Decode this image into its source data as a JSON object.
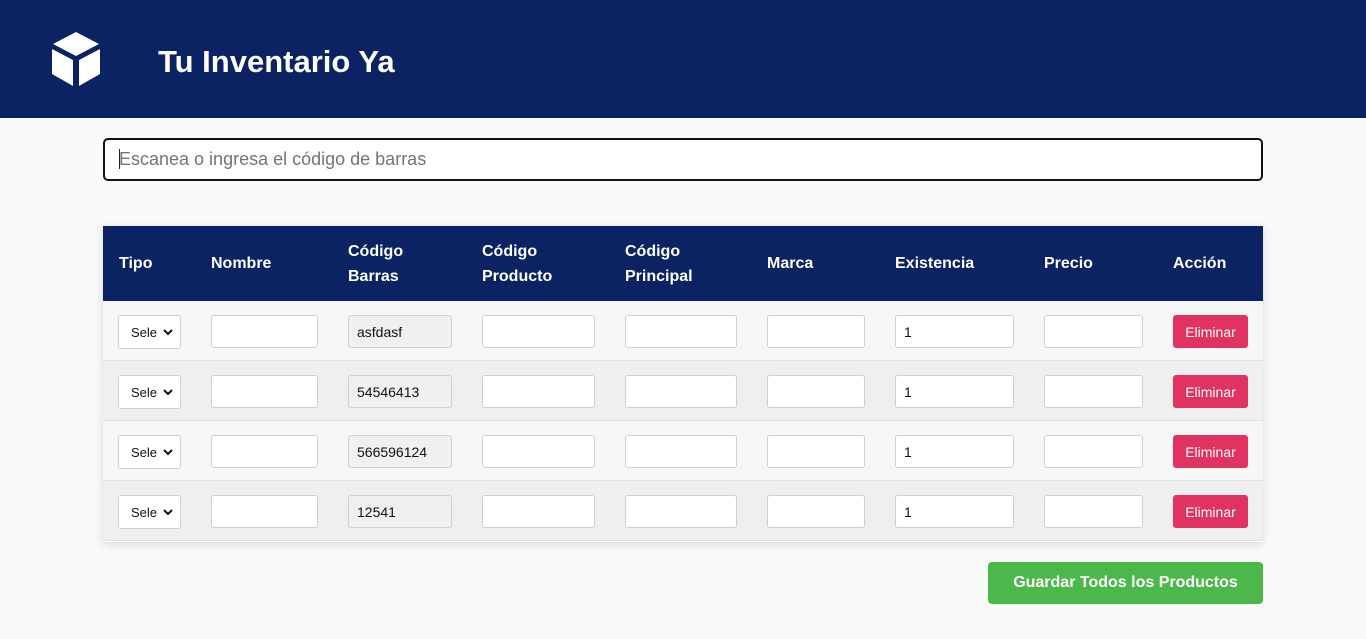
{
  "header": {
    "title": "Tu Inventario Ya",
    "logo_icon": "cube-icon",
    "background": "#0b2263"
  },
  "search": {
    "placeholder": "Escanea o ingresa el código de barras",
    "value": ""
  },
  "table": {
    "columns": {
      "tipo": "Tipo",
      "nombre": "Nombre",
      "codigo_barras": [
        "Código",
        "Barras"
      ],
      "codigo_producto": [
        "Código",
        "Producto"
      ],
      "codigo_principal": [
        "Código",
        "Principal"
      ],
      "marca": "Marca",
      "existencia": "Existencia",
      "precio": "Precio",
      "accion": "Acción"
    },
    "rows": [
      {
        "tipo": "Sele",
        "nombre": "",
        "codigo_barras": "asfdasf",
        "codigo_producto": "",
        "codigo_principal": "",
        "marca": "",
        "existencia": "1",
        "precio": "",
        "accion": "Eliminar"
      },
      {
        "tipo": "Sele",
        "nombre": "",
        "codigo_barras": "54546413",
        "codigo_producto": "",
        "codigo_principal": "",
        "marca": "",
        "existencia": "1",
        "precio": "",
        "accion": "Eliminar"
      },
      {
        "tipo": "Sele",
        "nombre": "",
        "codigo_barras": "566596124",
        "codigo_producto": "",
        "codigo_principal": "",
        "marca": "",
        "existencia": "1",
        "precio": "",
        "accion": "Eliminar"
      },
      {
        "tipo": "Sele",
        "nombre": "",
        "codigo_barras": "12541",
        "codigo_producto": "",
        "codigo_principal": "",
        "marca": "",
        "existencia": "1",
        "precio": "",
        "accion": "Eliminar"
      }
    ]
  },
  "save_button": {
    "label": "Guardar Todos los Productos"
  },
  "colors": {
    "accent": "#0b2263",
    "delete": "#e03361",
    "save": "#4cb74a"
  }
}
